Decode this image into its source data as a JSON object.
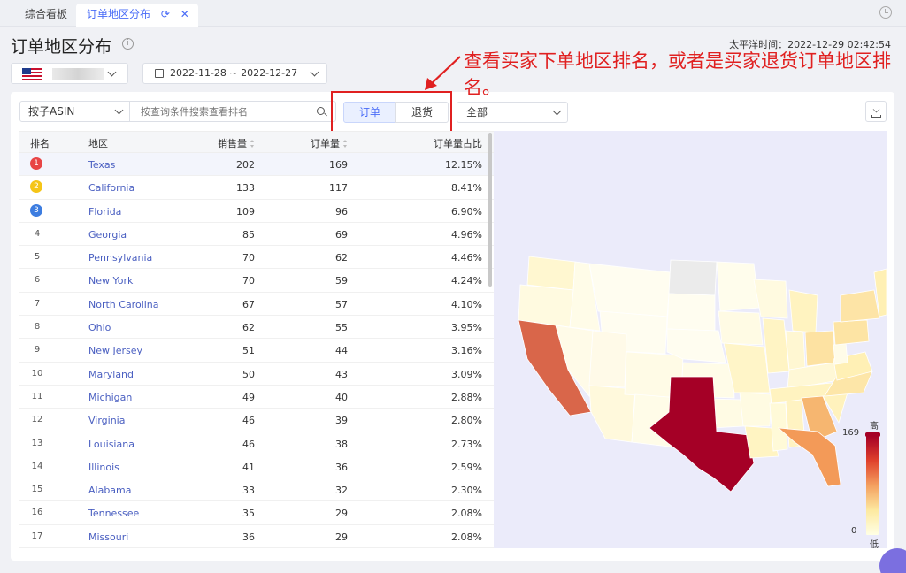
{
  "tabs": [
    {
      "label": "综合看板"
    },
    {
      "label": "订单地区分布"
    }
  ],
  "header": {
    "title": "订单地区分布",
    "timezone_text": "太平洋时间：2022-12-29 02:42:54",
    "date_range": "2022-11-28 ~ 2022-12-27"
  },
  "filters": {
    "asin_select": "按子ASIN",
    "search_placeholder": "按查询条件搜索查看排名",
    "seg_order": "订单",
    "seg_return": "退货",
    "status_select": "全部"
  },
  "annotation": {
    "text": "查看买家下单地区排名，或者是买家退货订单地区排名。"
  },
  "table": {
    "headers": {
      "rank": "排名",
      "region": "地区",
      "sales": "销售量",
      "orders": "订单量",
      "share": "订单量占比"
    },
    "rows": [
      {
        "rank": "1",
        "region": "Texas",
        "sales": "202",
        "orders": "169",
        "share": "12.15%"
      },
      {
        "rank": "2",
        "region": "California",
        "sales": "133",
        "orders": "117",
        "share": "8.41%"
      },
      {
        "rank": "3",
        "region": "Florida",
        "sales": "109",
        "orders": "96",
        "share": "6.90%"
      },
      {
        "rank": "4",
        "region": "Georgia",
        "sales": "85",
        "orders": "69",
        "share": "4.96%"
      },
      {
        "rank": "5",
        "region": "Pennsylvania",
        "sales": "70",
        "orders": "62",
        "share": "4.46%"
      },
      {
        "rank": "6",
        "region": "New York",
        "sales": "70",
        "orders": "59",
        "share": "4.24%"
      },
      {
        "rank": "7",
        "region": "North Carolina",
        "sales": "67",
        "orders": "57",
        "share": "4.10%"
      },
      {
        "rank": "8",
        "region": "Ohio",
        "sales": "62",
        "orders": "55",
        "share": "3.95%"
      },
      {
        "rank": "9",
        "region": "New Jersey",
        "sales": "51",
        "orders": "44",
        "share": "3.16%"
      },
      {
        "rank": "10",
        "region": "Maryland",
        "sales": "50",
        "orders": "43",
        "share": "3.09%"
      },
      {
        "rank": "11",
        "region": "Michigan",
        "sales": "49",
        "orders": "40",
        "share": "2.88%"
      },
      {
        "rank": "12",
        "region": "Virginia",
        "sales": "46",
        "orders": "39",
        "share": "2.80%"
      },
      {
        "rank": "13",
        "region": "Louisiana",
        "sales": "46",
        "orders": "38",
        "share": "2.73%"
      },
      {
        "rank": "14",
        "region": "Illinois",
        "sales": "41",
        "orders": "36",
        "share": "2.59%"
      },
      {
        "rank": "15",
        "region": "Alabama",
        "sales": "33",
        "orders": "32",
        "share": "2.30%"
      },
      {
        "rank": "16",
        "region": "Tennessee",
        "sales": "35",
        "orders": "29",
        "share": "2.08%"
      },
      {
        "rank": "17",
        "region": "Missouri",
        "sales": "36",
        "orders": "29",
        "share": "2.08%"
      }
    ],
    "medal_colors": [
      "#e84545",
      "#f5c518",
      "#3d7de0"
    ]
  },
  "map": {
    "legend_high": "高",
    "legend_low": "低",
    "legend_max": "169",
    "legend_min": "0",
    "scale_colors": [
      "#a50026",
      "#ffffe5"
    ]
  }
}
